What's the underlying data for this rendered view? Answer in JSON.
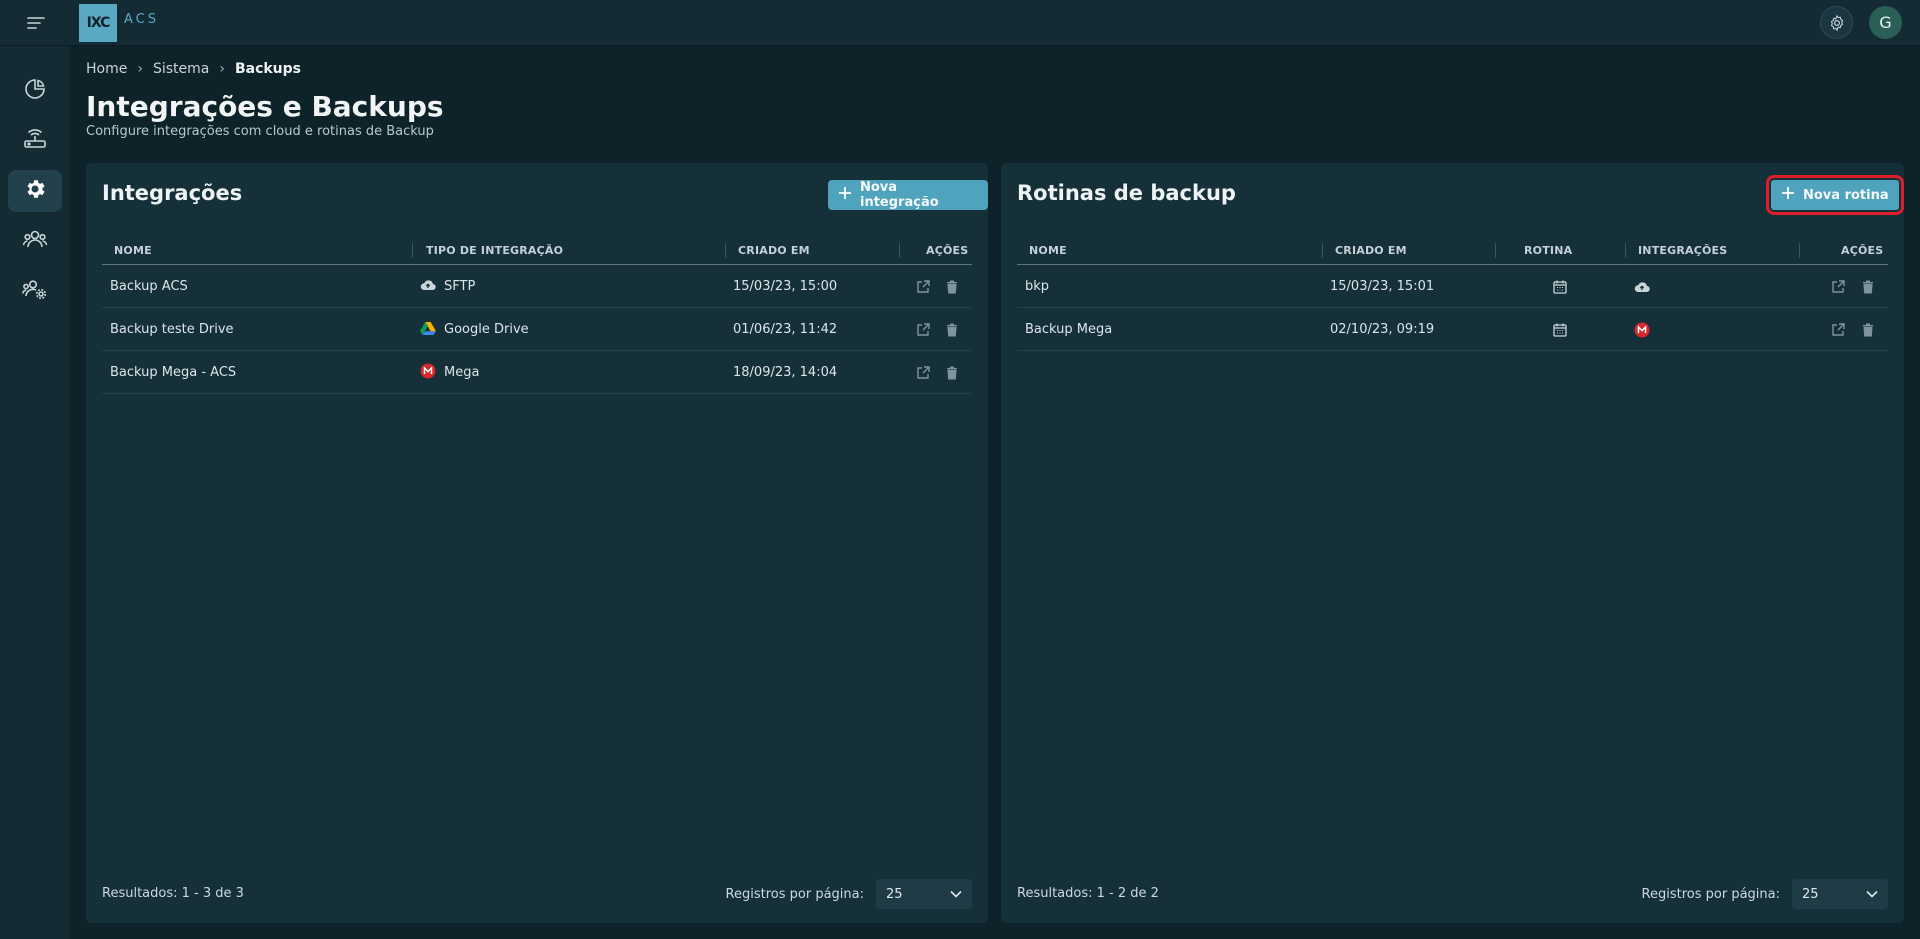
{
  "app": {
    "logo_mark": "IXC",
    "logo_name": "ACS",
    "avatar_initial": "G"
  },
  "breadcrumb": [
    "Home",
    "Sistema",
    "Backups"
  ],
  "page": {
    "title": "Integrações e Backups",
    "subtitle": "Configure integrações com cloud e rotinas de Backup"
  },
  "integrations": {
    "title": "Integrações",
    "new_button": "Nova integração",
    "columns": [
      "NOME",
      "TIPO DE INTEGRAÇÃO",
      "CRIADO EM",
      "AÇÕES"
    ],
    "rows": [
      {
        "name": "Backup ACS",
        "type": "SFTP",
        "type_icon": "cloud-upload-icon",
        "created": "15/03/23, 15:00"
      },
      {
        "name": "Backup teste Drive",
        "type": "Google Drive",
        "type_icon": "google-drive-icon",
        "created": "01/06/23, 11:42"
      },
      {
        "name": "Backup Mega - ACS",
        "type": "Mega",
        "type_icon": "mega-icon",
        "created": "18/09/23, 14:04"
      }
    ],
    "results": "Resultados: 1 - 3 de 3",
    "per_page_label": "Registros por página:",
    "per_page_value": "25"
  },
  "backups": {
    "title": "Rotinas de backup",
    "new_button": "Nova rotina",
    "columns": [
      "NOME",
      "CRIADO EM",
      "ROTINA",
      "INTEGRAÇÕES",
      "AÇÕES"
    ],
    "rows": [
      {
        "name": "bkp",
        "created": "15/03/23, 15:01",
        "routine_icon": "calendar-icon",
        "integration_icon": "cloud-upload-icon"
      },
      {
        "name": "Backup Mega",
        "created": "02/10/23, 09:19",
        "routine_icon": "calendar-icon",
        "integration_icon": "mega-icon"
      }
    ],
    "results": "Resultados: 1 - 2 de 2",
    "per_page_label": "Registros por página:",
    "per_page_value": "25"
  },
  "colors": {
    "accent": "#4fa3bd",
    "background": "#0e2229",
    "panel": "#16303a",
    "highlight": "#e01d2a",
    "mega": "#d9272e"
  }
}
